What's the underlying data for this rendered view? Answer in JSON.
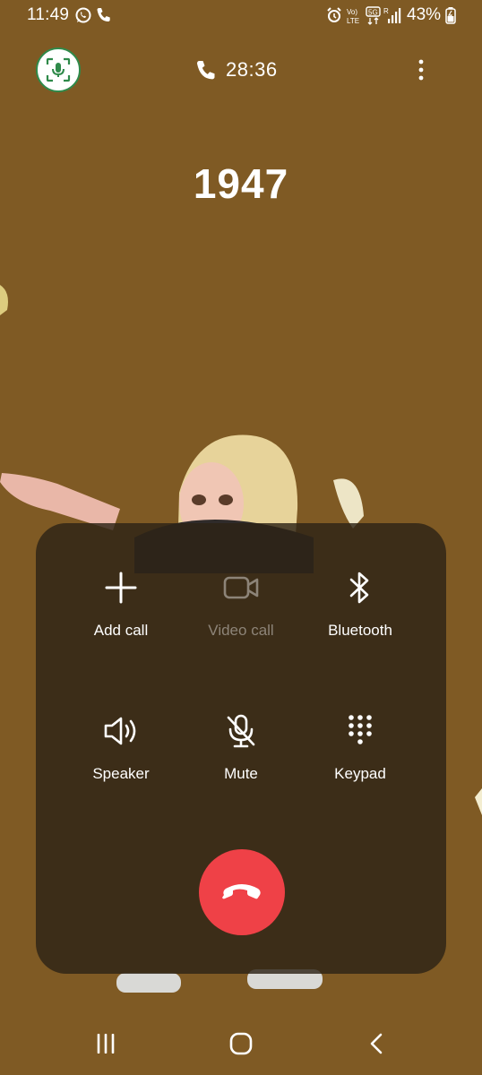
{
  "status_bar": {
    "time": "11:49",
    "battery": "43%",
    "icons": [
      "whatsapp-icon",
      "phone-icon",
      "alarm-icon",
      "volte-icon",
      "5g-icon",
      "signal-icon",
      "battery-icon"
    ]
  },
  "call": {
    "timer": "28:36",
    "number": "1947"
  },
  "controls": {
    "add_call": "Add call",
    "video_call": "Video call",
    "bluetooth": "Bluetooth",
    "speaker": "Speaker",
    "mute": "Mute",
    "keypad": "Keypad"
  },
  "colors": {
    "background": "#7f5a24",
    "end_call": "#ef4147",
    "voice_recorder_accent": "#2f8a4a"
  }
}
